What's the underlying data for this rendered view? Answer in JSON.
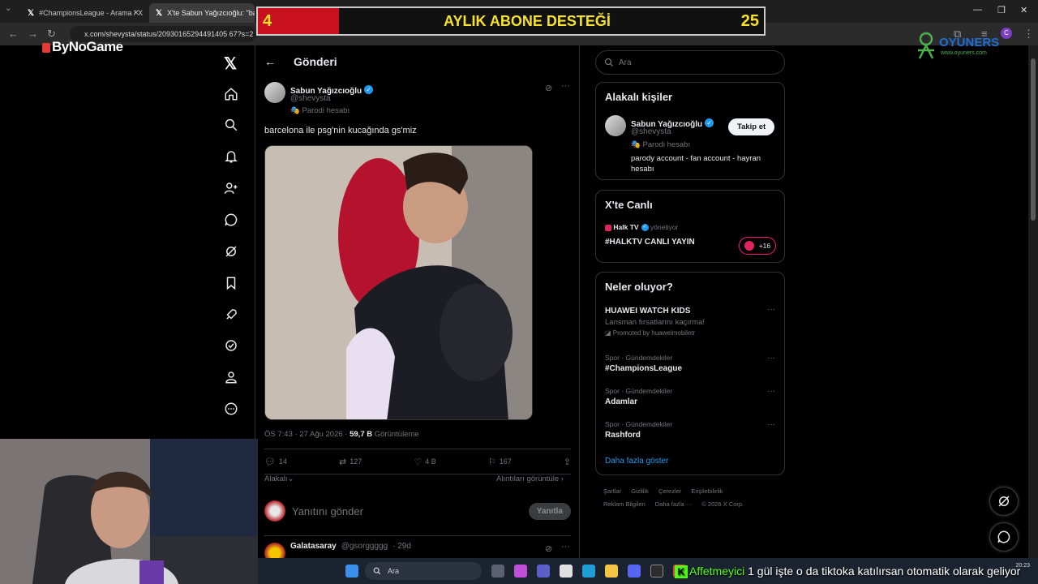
{
  "browser": {
    "tabs": [
      {
        "label": "#ChampionsLeague - Arama / X"
      },
      {
        "label": "X'te Sabun Yağızcıoğlu: \"ba"
      }
    ],
    "url": "x.com/shevysta/status/20930165294491405 67?s=2"
  },
  "overlay": {
    "sub_banner": {
      "left_value": "4",
      "title": "AYLIK ABONE DESTEĞİ",
      "right_value": "25"
    },
    "sponsor": "ByNoGame",
    "brand": {
      "name": "OYUNERS",
      "url": "www.oyuners.com"
    },
    "chat": {
      "user": "Affetmeyici",
      "message": "1 gül işte o da tiktoka katılırsan otomatik olarak geliyor"
    }
  },
  "x": {
    "page_title": "Gönderi",
    "post": {
      "author_name": "Sabun Yağızcıoğlu",
      "author_handle": "@shevysta",
      "parody_label": "Parodi hesabı",
      "text": "barcelona ile psg'nin kucağında gs'miz",
      "meta_time": "ÖS 7:43 · 27 Ağu 2026 ·",
      "views_count": "59,7 B",
      "views_label": "Görüntüleme",
      "replies": "14",
      "reposts": "127",
      "likes": "4 B",
      "bookmarks": "167",
      "related_label": "Alakalı",
      "quotes_label": "Alıntıları görüntüle"
    },
    "reply_box": {
      "placeholder": "Yanıtını gönder",
      "button": "Yanıtla"
    },
    "next_reply": {
      "name": "Galatasaray",
      "handle": "@gsorggggg",
      "time": "· 29d"
    },
    "search": {
      "placeholder": "Ara"
    },
    "related_people": {
      "title": "Alakalı kişiler",
      "name": "Sabun Yağızcıoğlu",
      "handle": "@shevysta",
      "parody_label": "Parodi hesabı",
      "bio": "parody account - fan account - hayran hesabı",
      "follow_label": "Takip et"
    },
    "live": {
      "title": "X'te Canlı",
      "host": "Halk TV",
      "host_suffix": "yönetiyor",
      "broadcast": "#HALKTV CANLI YAYIN",
      "listeners": "+16"
    },
    "trends": {
      "title": "Neler oluyor?",
      "items": [
        {
          "category": "",
          "name": "HUAWEI WATCH KIDS",
          "sub": "Lansman fırsatlarını kaçırma!",
          "promo": "Promoted by huaweimobiletr"
        },
        {
          "category": "Spor · Gündemdekiler",
          "name": "#ChampionsLeague"
        },
        {
          "category": "Spor · Gündemdekiler",
          "name": "Adamlar"
        },
        {
          "category": "Spor · Gündemdekiler",
          "name": "Rashford"
        }
      ],
      "show_more": "Daha fazla göster"
    },
    "footer": [
      "Şartlar",
      "Gizlilik",
      "Çerezler",
      "Erişilebilirlik",
      "Reklam Bilgileri",
      "Daha fazla ···",
      "© 2026 X Corp."
    ]
  },
  "taskbar": {
    "search_placeholder": "Ara",
    "time": "20:23"
  }
}
